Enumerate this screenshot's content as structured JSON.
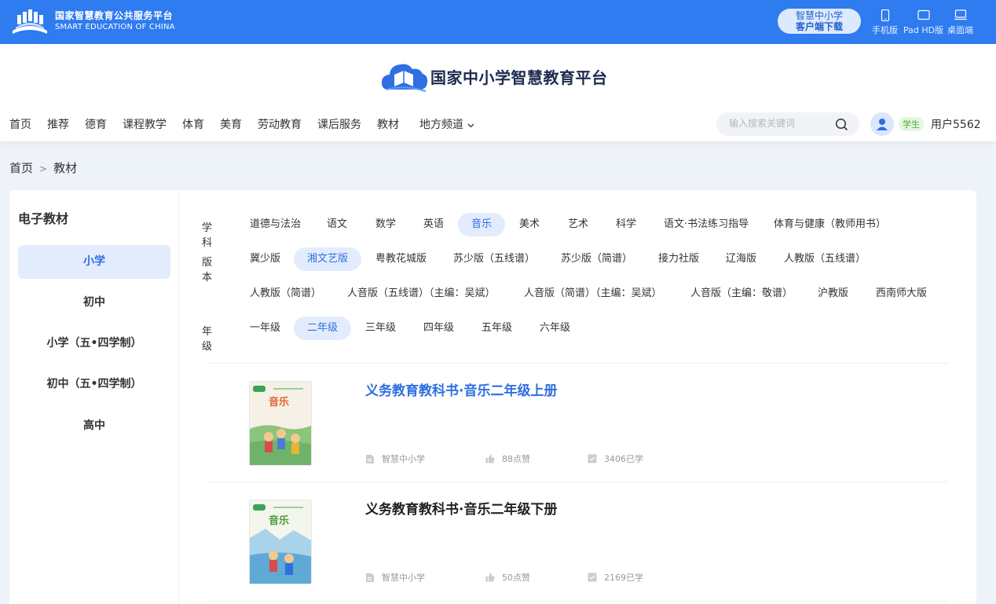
{
  "topbar": {
    "logo_cn": "国家智慧教育公共服务平台",
    "logo_en": "SMART EDUCATION OF CHINA",
    "download_line1": "智慧中小学",
    "download_line2": "客户端下载",
    "devices": [
      {
        "label": "手机版",
        "icon": "phone-icon"
      },
      {
        "label": "Pad HD版",
        "icon": "tablet-icon"
      },
      {
        "label": "桌面端",
        "icon": "desktop-icon"
      }
    ]
  },
  "header": {
    "brand_title": "国家中小学智慧教育平台",
    "nav": [
      "首页",
      "推荐",
      "德育",
      "课程教学",
      "体育",
      "美育",
      "劳动教育",
      "课后服务",
      "教材",
      "地方频道"
    ],
    "search_placeholder": "输入搜索关键词",
    "user_role": "学生",
    "user_name": "用户5562"
  },
  "breadcrumb": [
    "首页",
    "教材"
  ],
  "sidebar": {
    "title": "电子教材",
    "items": [
      "小学",
      "初中",
      "小学（五•四学制）",
      "初中（五•四学制）",
      "高中"
    ],
    "active_index": 0
  },
  "filters": {
    "subject": {
      "label": "学科",
      "options": [
        "道德与法治",
        "语文",
        "数学",
        "英语",
        "音乐",
        "美术",
        "艺术",
        "科学",
        "语文·书法练习指导",
        "体育与健康（教师用书）"
      ],
      "selected": "音乐"
    },
    "edition": {
      "label": "版本",
      "options": [
        "冀少版",
        "湘文艺版",
        "粤教花城版",
        "苏少版（五线谱）",
        "苏少版（简谱）",
        "接力社版",
        "辽海版",
        "人教版（五线谱）",
        "人教版（简谱）",
        "人音版（五线谱）（主编：吴斌）",
        "人音版（简谱）（主编：吴斌）",
        "人音版（主编：敬谱）",
        "沪教版",
        "西南师大版"
      ],
      "selected": "湘文艺版"
    },
    "grade": {
      "label": "年级",
      "options": [
        "一年级",
        "二年级",
        "三年级",
        "四年级",
        "五年级",
        "六年级"
      ],
      "selected": "二年级"
    }
  },
  "books": [
    {
      "title": "义务教育教科书·音乐二年级上册",
      "publisher": "智慧中小学",
      "likes": "88点赞",
      "learners": "3406已学",
      "cover_text": "音乐",
      "highlighted": true
    },
    {
      "title": "义务教育教科书·音乐二年级下册",
      "publisher": "智慧中小学",
      "likes": "50点赞",
      "learners": "2169已学",
      "cover_text": "音乐",
      "highlighted": false
    }
  ],
  "colors": {
    "topbar": "#2f7bf0",
    "accent": "#2f6fe0",
    "selected_bg": "#e3ecfc",
    "page_bg": "#eef2f9"
  }
}
